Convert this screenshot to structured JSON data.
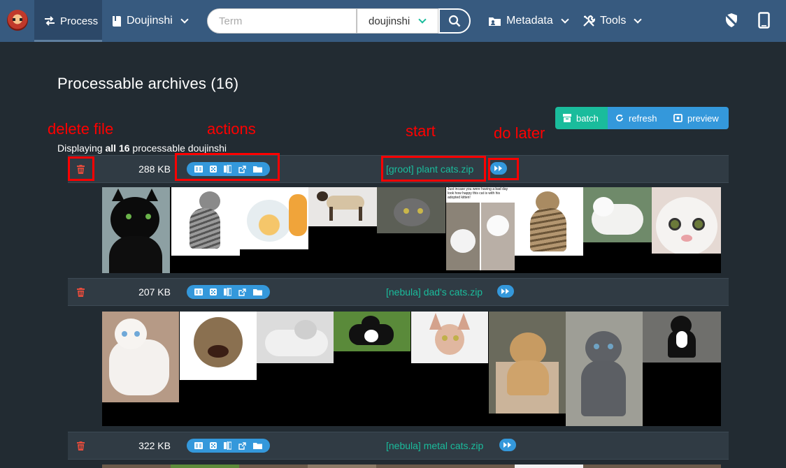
{
  "nav": {
    "process_label": "Process",
    "doujinshi_label": "Doujinshi",
    "search_placeholder": "Term",
    "search_select": "doujinshi",
    "metadata_label": "Metadata",
    "tools_label": "Tools"
  },
  "page": {
    "title": "Processable archives (16)",
    "displaying_prefix": "Displaying",
    "displaying_strong": "all 16",
    "displaying_suffix": "processable doujinshi"
  },
  "buttons": {
    "batch": "batch",
    "refresh": "refresh",
    "preview": "preview"
  },
  "annotations": {
    "delete_file": "delete file",
    "actions": "actions",
    "start": "start",
    "do_later": "do later"
  },
  "archives": [
    {
      "size": "288 KB",
      "name": "[groot] plant cats.zip"
    },
    {
      "size": "207 KB",
      "name": "[nebula] dad's cats.zip"
    },
    {
      "size": "322 KB",
      "name": "[nebula] metal cats.zip"
    }
  ],
  "meme_caption": "Just incase you were having a bad day look how happy this cat is with his adopted kitten!",
  "icons": {
    "logo": "app-logo",
    "process": "swap-arrows-icon",
    "doujinshi": "book-icon",
    "search": "search-icon",
    "metadata": "address-card-icon",
    "tools": "tools-icon",
    "shield": "shield-slash-icon",
    "device": "tablet-icon",
    "batch": "archive-icon",
    "refresh": "refresh-icon",
    "preview": "preview-icon",
    "trash": "trash-icon",
    "view": "reader-icon",
    "random": "dice-icon",
    "compare": "compare-icon",
    "open": "external-link-icon",
    "folder": "folder-icon",
    "later": "forward-icon"
  },
  "colors": {
    "navbar": "#375a7f",
    "background": "#222b32",
    "row": "#303b44",
    "accent_green": "#1abc9c",
    "accent_blue": "#3498db",
    "danger": "#e74c3c",
    "annotation_red": "#ff0000"
  }
}
